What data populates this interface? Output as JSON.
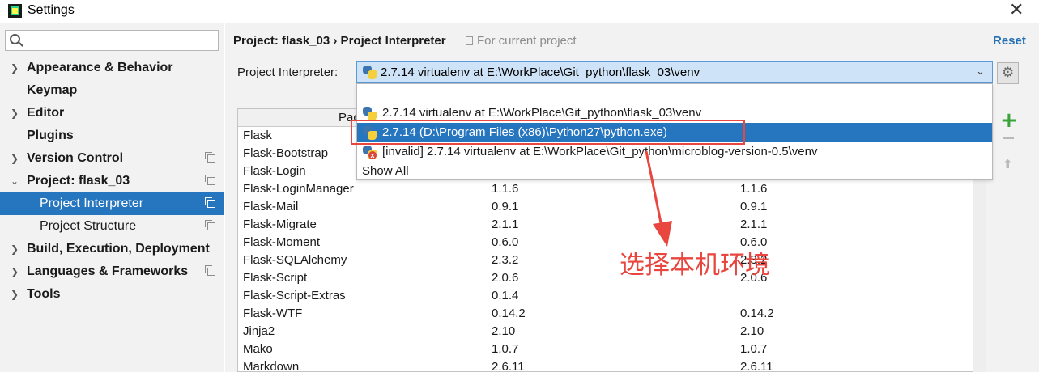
{
  "window": {
    "title": "Settings",
    "close_glyph": "✕",
    "app_icon": "pycharm-icon"
  },
  "sidebar": {
    "search_placeholder": "",
    "items": [
      {
        "label": "Appearance & Behavior",
        "arrow": "❯",
        "bold": true
      },
      {
        "label": "Keymap",
        "arrow": "",
        "bold": true
      },
      {
        "label": "Editor",
        "arrow": "❯",
        "bold": true
      },
      {
        "label": "Plugins",
        "arrow": "",
        "bold": true
      },
      {
        "label": "Version Control",
        "arrow": "❯",
        "bold": true
      },
      {
        "label": "Project: flask_03",
        "arrow": "⌄",
        "bold": true
      },
      {
        "label": "Project Interpreter",
        "arrow": "",
        "bold": false,
        "selected": true
      },
      {
        "label": "Project Structure",
        "arrow": "",
        "bold": false
      },
      {
        "label": "Build, Execution, Deployment",
        "arrow": "❯",
        "bold": true
      },
      {
        "label": "Languages & Frameworks",
        "arrow": "❯",
        "bold": true
      },
      {
        "label": "Tools",
        "arrow": "❯",
        "bold": true
      }
    ]
  },
  "header": {
    "breadcrumb": "Project: flask_03 › Project Interpreter",
    "scope_note": "For current project",
    "reset_label": "Reset"
  },
  "interpreter": {
    "label": "Project Interpreter:",
    "selected_value": "2.7.14 virtualenv at E:\\WorkPlace\\Git_python\\flask_03\\venv",
    "chevron": "⌄",
    "gear_glyph": "⚙"
  },
  "dropdown": {
    "options": [
      {
        "text": "2.7.14 virtualenv at E:\\WorkPlace\\Git_python\\flask_03\\venv",
        "icon": "python-icon"
      },
      {
        "text": "2.7.14 (D:\\Program Files (x86)\\Python27\\python.exe)",
        "icon": "python-icon",
        "highlighted": true
      },
      {
        "text": "[invalid] 2.7.14 virtualenv at E:\\WorkPlace\\Git_python\\microblog-version-0.5\\venv",
        "icon": "python-invalid-icon"
      }
    ],
    "show_all_label": "Show All"
  },
  "table": {
    "header_partial": "Pac",
    "rows": [
      {
        "name": "Flask",
        "version": "",
        "latest": ""
      },
      {
        "name": "Flask-Bootstrap",
        "version": "",
        "latest": ""
      },
      {
        "name": "Flask-Login",
        "version": "",
        "latest": ""
      },
      {
        "name": "Flask-LoginManager",
        "version": "1.1.6",
        "latest": "1.1.6"
      },
      {
        "name": "Flask-Mail",
        "version": "0.9.1",
        "latest": "0.9.1"
      },
      {
        "name": "Flask-Migrate",
        "version": "2.1.1",
        "latest": "2.1.1"
      },
      {
        "name": "Flask-Moment",
        "version": "0.6.0",
        "latest": "0.6.0"
      },
      {
        "name": "Flask-SQLAlchemy",
        "version": "2.3.2",
        "latest": "2.3.2"
      },
      {
        "name": "Flask-Script",
        "version": "2.0.6",
        "latest": "2.0.6"
      },
      {
        "name": "Flask-Script-Extras",
        "version": "0.1.4",
        "latest": ""
      },
      {
        "name": "Flask-WTF",
        "version": "0.14.2",
        "latest": "0.14.2"
      },
      {
        "name": "Jinja2",
        "version": "2.10",
        "latest": "2.10"
      },
      {
        "name": "Mako",
        "version": "1.0.7",
        "latest": "1.0.7"
      },
      {
        "name": "Markdown",
        "version": "2.6.11",
        "latest": "2.6.11"
      }
    ]
  },
  "tools": {
    "add_glyph": "+",
    "up_glyph": "⬆"
  },
  "annotation": {
    "text": "选择本机环境",
    "color": "#e8463e"
  },
  "colors": {
    "selection": "#2675bf",
    "link": "#2470b3",
    "annotation_red": "#e8463e",
    "combo_bg": "#cfe3f8"
  }
}
